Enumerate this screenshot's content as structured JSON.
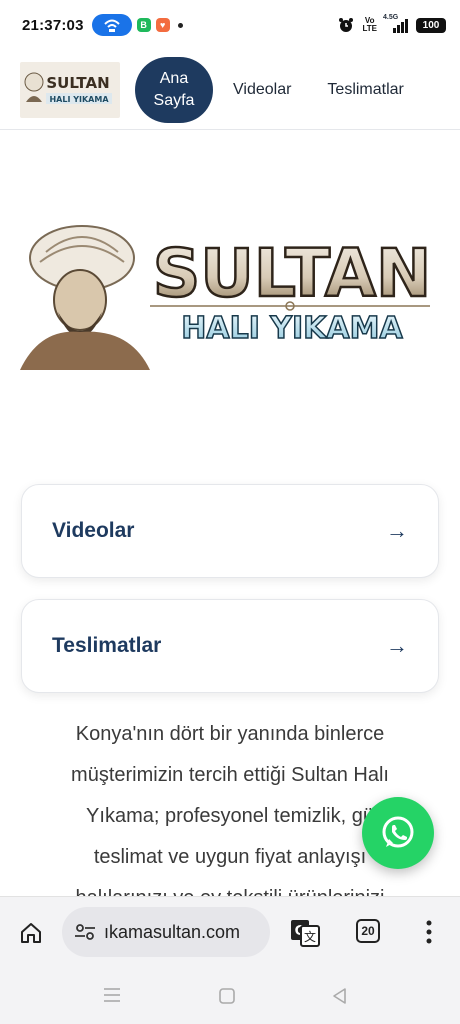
{
  "status_bar": {
    "time": "21:37:03",
    "volte_top": "Vo",
    "volte_bottom": "LTE",
    "network": "4.5G",
    "battery": "100",
    "icons": [
      "hotspot-icon",
      "app-b-icon",
      "app-heart-icon",
      "notification-dot",
      "alarm-icon",
      "signal-icon"
    ]
  },
  "header": {
    "logo_alt_top": "SULTAN",
    "logo_alt_bottom": "HALI YIKAMA",
    "nav": {
      "active_line1": "Ana",
      "active_line2": "Sayfa",
      "videos": "Videolar",
      "deliveries": "Teslimatlar"
    }
  },
  "hero": {
    "title": "SULTAN",
    "subtitle": "HALI YIKAMA"
  },
  "cards": [
    {
      "label": "Videolar",
      "arrow": "→"
    },
    {
      "label": "Teslimatlar",
      "arrow": "→"
    }
  ],
  "about": {
    "line1": "Konya'nın dört bir yanında binlerce",
    "line2": "müşterimizin tercih ettiği Sultan Halı",
    "line3": "Yıkama; profesyonel temizlik, gü",
    "line4": "teslimat ve uygun fiyat anlayışı",
    "line5": "halılarınızı ve ev tekstili ürünlerinizi"
  },
  "browser": {
    "url": "ıkamasultan.com",
    "tab_count": "20"
  },
  "colors": {
    "primary": "#1e3a5f",
    "whatsapp": "#25d366",
    "hotspot": "#1a73e8"
  }
}
